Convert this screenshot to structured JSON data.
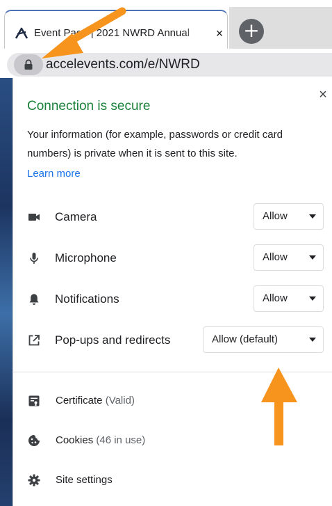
{
  "tab": {
    "title": "Event Page | 2021 NWRD Annual",
    "close_glyph": "×",
    "favicon": "accelevents-logo-icon"
  },
  "new_tab": {
    "glyph": "+"
  },
  "omnibox": {
    "url": "accelevents.com/e/NWRD",
    "lock_icon": "lock-icon"
  },
  "popup": {
    "close_glyph": "×",
    "title": "Connection is secure",
    "description": "Your information (for example, passwords or credit card numbers) is private when it is sent to this site.",
    "learn_more": "Learn more",
    "permissions": [
      {
        "label": "Camera",
        "value": "Allow",
        "icon": "camera-icon"
      },
      {
        "label": "Microphone",
        "value": "Allow",
        "icon": "microphone-icon"
      },
      {
        "label": "Notifications",
        "value": "Allow",
        "icon": "bell-icon"
      },
      {
        "label": "Pop-ups and redirects",
        "value": "Allow (default)",
        "icon": "external-link-icon"
      }
    ],
    "links": [
      {
        "label": "Certificate",
        "meta": "(Valid)",
        "icon": "certificate-icon"
      },
      {
        "label": "Cookies",
        "meta": "(46 in use)",
        "icon": "cookie-icon"
      },
      {
        "label": "Site settings",
        "meta": "",
        "icon": "gear-icon"
      }
    ]
  },
  "colors": {
    "secure_green": "#188038",
    "link_blue": "#1a73e8",
    "annotation_orange": "#f7941d",
    "tab_accent": "#4b73b6"
  }
}
